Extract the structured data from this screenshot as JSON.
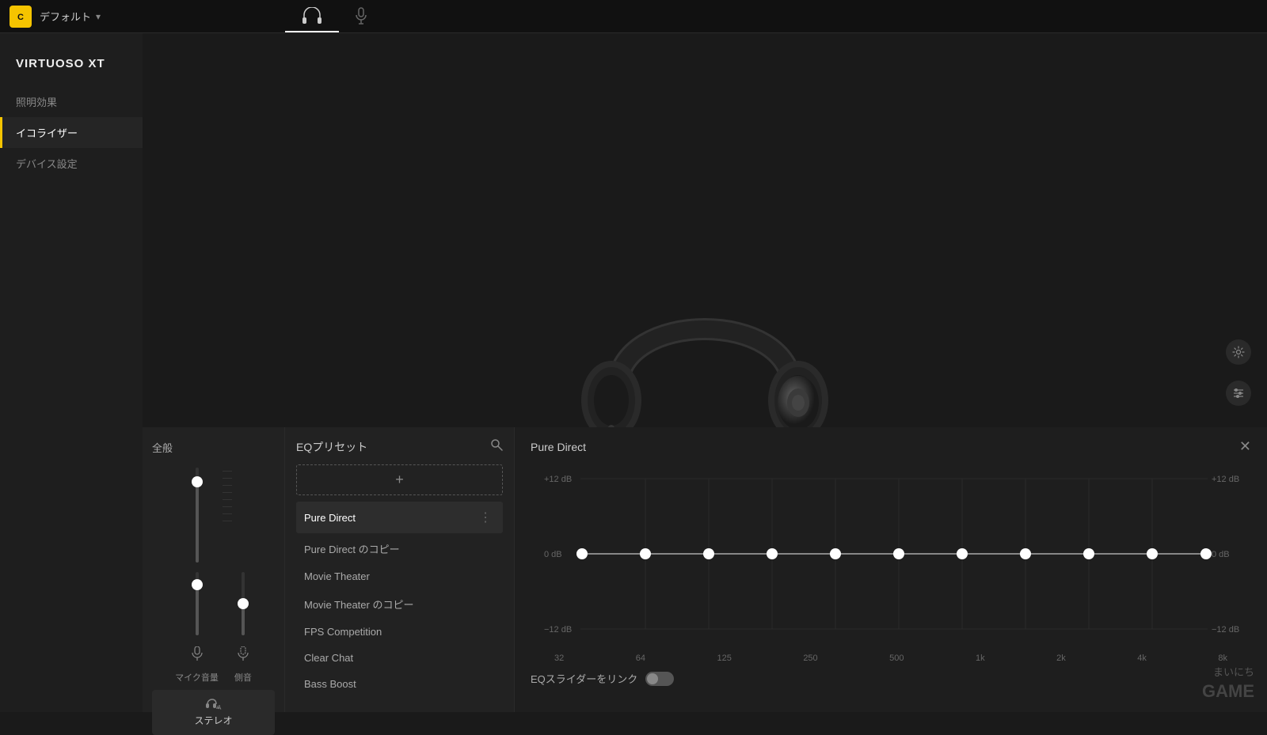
{
  "topBar": {
    "logo": "C",
    "preset": "デフォルト",
    "dropdownIcon": "▾",
    "tabs": [
      {
        "label": "headphone-icon",
        "active": true
      },
      {
        "label": "mic-icon",
        "active": false
      }
    ]
  },
  "sidebar": {
    "deviceTitle": "VIRTUOSO XT",
    "navItems": [
      {
        "label": "照明効果",
        "active": false
      },
      {
        "label": "イコライザー",
        "active": true
      },
      {
        "label": "デバイス設定",
        "active": false
      }
    ]
  },
  "volumePanel": {
    "title": "全般",
    "sliders": [
      {
        "icon": "🎤",
        "label": "マイク音量",
        "value": 85
      },
      {
        "icon": "🎙",
        "label": "側音",
        "value": 50
      }
    ],
    "stereoBtn": "ステレオ",
    "stereoBtnIcon": "🎧"
  },
  "eqPreset": {
    "title": "EQプリセット",
    "searchIcon": "🔍",
    "addBtn": "+",
    "presets": [
      {
        "label": "Pure Direct",
        "active": true
      },
      {
        "label": "Pure Direct のコピー",
        "active": false
      },
      {
        "label": "Movie Theater",
        "active": false
      },
      {
        "label": "Movie Theater のコピー",
        "active": false
      },
      {
        "label": "FPS Competition",
        "active": false
      },
      {
        "label": "Clear Chat",
        "active": false
      },
      {
        "label": "Bass Boost",
        "active": false
      }
    ]
  },
  "eqGraph": {
    "title": "Pure Direct",
    "closeIcon": "✕",
    "labels": {
      "top": "+ 12 dB",
      "topRight": "+ 12 dB",
      "mid": "0 dB",
      "midRight": "0 dB",
      "bottom": "− 12 dB",
      "bottomRight": "− 12 dB"
    },
    "freqLabels": [
      "32",
      "64",
      "125",
      "250",
      "500",
      "1k",
      "2k",
      "4k",
      "8k"
    ],
    "points": [
      0,
      0,
      0,
      0,
      0,
      0,
      0,
      0,
      0,
      0,
      0
    ],
    "linkLabel": "EQスライダーをリンク"
  },
  "watermark": {
    "line1": "まいにち",
    "line2": "GAME"
  }
}
